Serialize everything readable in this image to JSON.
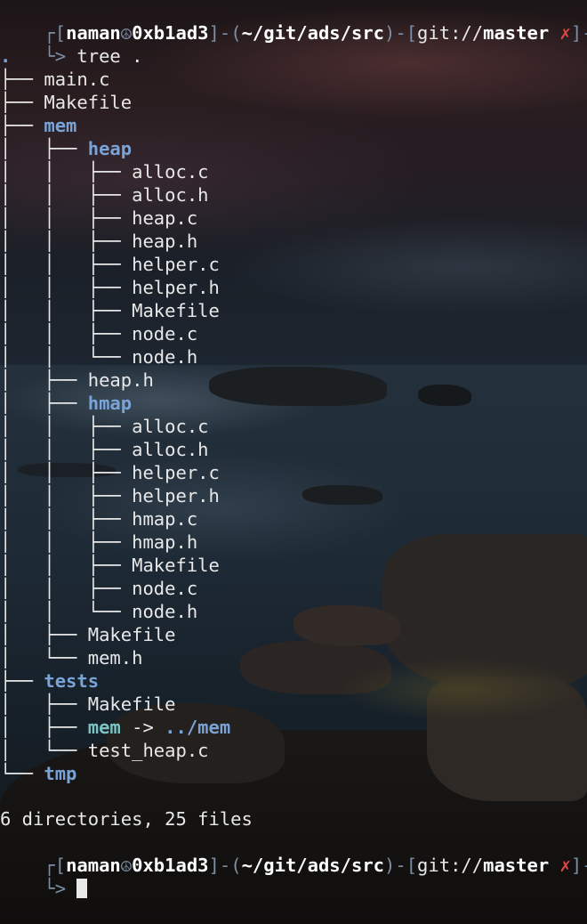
{
  "prompt1": {
    "open": "┌[",
    "user": "naman",
    "peace": "☮",
    "host": "0xb1ad3",
    "sep1": "]-(",
    "path": "~/git/ads/src",
    "sep2": ")-[",
    "git": "git://",
    "branch": "master",
    "dirty": "✗",
    "close": "]-"
  },
  "command_line": {
    "arrow": "└> ",
    "command": "tree ."
  },
  "tree": {
    "root": ".",
    "entries": [
      {
        "prefix": "├── ",
        "name": "main.c",
        "type": "file"
      },
      {
        "prefix": "├── ",
        "name": "Makefile",
        "type": "file"
      },
      {
        "prefix": "├── ",
        "name": "mem",
        "type": "dir"
      },
      {
        "prefix": "│   ├── ",
        "name": "heap",
        "type": "dir"
      },
      {
        "prefix": "│   │   ├── ",
        "name": "alloc.c",
        "type": "file"
      },
      {
        "prefix": "│   │   ├── ",
        "name": "alloc.h",
        "type": "file"
      },
      {
        "prefix": "│   │   ├── ",
        "name": "heap.c",
        "type": "file"
      },
      {
        "prefix": "│   │   ├── ",
        "name": "heap.h",
        "type": "file"
      },
      {
        "prefix": "│   │   ├── ",
        "name": "helper.c",
        "type": "file"
      },
      {
        "prefix": "│   │   ├── ",
        "name": "helper.h",
        "type": "file"
      },
      {
        "prefix": "│   │   ├── ",
        "name": "Makefile",
        "type": "file"
      },
      {
        "prefix": "│   │   ├── ",
        "name": "node.c",
        "type": "file"
      },
      {
        "prefix": "│   │   └── ",
        "name": "node.h",
        "type": "file"
      },
      {
        "prefix": "│   ├── ",
        "name": "heap.h",
        "type": "file"
      },
      {
        "prefix": "│   ├── ",
        "name": "hmap",
        "type": "dir"
      },
      {
        "prefix": "│   │   ├── ",
        "name": "alloc.c",
        "type": "file"
      },
      {
        "prefix": "│   │   ├── ",
        "name": "alloc.h",
        "type": "file"
      },
      {
        "prefix": "│   │   ├── ",
        "name": "helper.c",
        "type": "file"
      },
      {
        "prefix": "│   │   ├── ",
        "name": "helper.h",
        "type": "file"
      },
      {
        "prefix": "│   │   ├── ",
        "name": "hmap.c",
        "type": "file"
      },
      {
        "prefix": "│   │   ├── ",
        "name": "hmap.h",
        "type": "file"
      },
      {
        "prefix": "│   │   ├── ",
        "name": "Makefile",
        "type": "file"
      },
      {
        "prefix": "│   │   ├── ",
        "name": "node.c",
        "type": "file"
      },
      {
        "prefix": "│   │   └── ",
        "name": "node.h",
        "type": "file"
      },
      {
        "prefix": "│   ├── ",
        "name": "Makefile",
        "type": "file"
      },
      {
        "prefix": "│   └── ",
        "name": "mem.h",
        "type": "file"
      },
      {
        "prefix": "├── ",
        "name": "tests",
        "type": "dir"
      },
      {
        "prefix": "│   ├── ",
        "name": "Makefile",
        "type": "file"
      },
      {
        "prefix": "│   ├── ",
        "name": "mem",
        "type": "link",
        "arrow": " -> ",
        "target": "../mem"
      },
      {
        "prefix": "│   └── ",
        "name": "test_heap.c",
        "type": "file"
      },
      {
        "prefix": "└── ",
        "name": "tmp",
        "type": "dir"
      }
    ]
  },
  "summary": "6 directories, 25 files",
  "prompt2": {
    "open": "┌[",
    "user": "naman",
    "peace": "☮",
    "host": "0xb1ad3",
    "sep1": "]-(",
    "path": "~/git/ads/src",
    "sep2": ")-[",
    "git": "git://",
    "branch": "master",
    "dirty": "✗",
    "close": "]-",
    "arrow": "└> "
  },
  "colors": {
    "directory": "#7aa4d8",
    "symlink": "#7ac4c4",
    "dirty": "#e04848",
    "frame": "#7c8ea6"
  }
}
